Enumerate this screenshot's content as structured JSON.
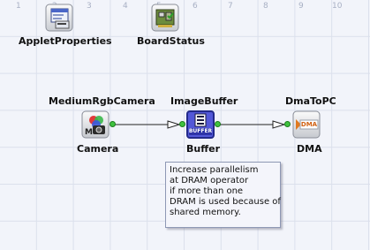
{
  "ruler": [
    "1",
    "2",
    "3",
    "4",
    "5",
    "6",
    "7",
    "8",
    "9",
    "10"
  ],
  "applets": [
    {
      "name": "AppletProperties",
      "icon": "applet-properties-icon"
    },
    {
      "name": "BoardStatus",
      "icon": "board-status-icon"
    }
  ],
  "operators": [
    {
      "type": "MediumRgbCamera",
      "instance": "Camera",
      "icon": "camera-icon"
    },
    {
      "type": "ImageBuffer",
      "instance": "Buffer",
      "icon": "buffer-icon",
      "icon_text": "BUFFER"
    },
    {
      "type": "DmaToPC",
      "instance": "DMA",
      "icon": "dma-icon",
      "icon_text": "DMA"
    }
  ],
  "tooltip": {
    "lines": [
      "Increase parallelism",
      "at DRAM operator",
      "if more than one",
      "DRAM is used because of",
      "shared memory."
    ]
  },
  "colors": {
    "grid_bg": "#f2f4fa",
    "grid_line": "#dbe0ec",
    "port": "#3fc23f",
    "buffer_accent": "#3a44c8",
    "dma_accent": "#e07a20"
  }
}
